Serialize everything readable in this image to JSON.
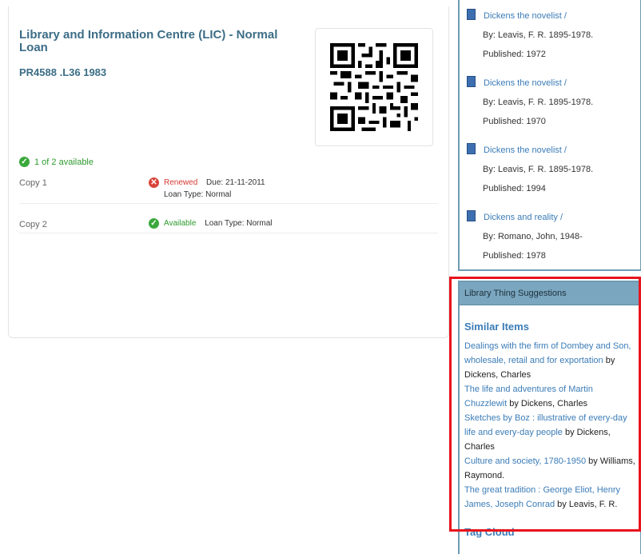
{
  "holding": {
    "location": "Library and Information Centre (LIC) - Normal Loan",
    "call_number": "PR4588 .L36 1983",
    "availability": "1 of 2 available",
    "copies": [
      {
        "label": "Copy 1",
        "status": "Renewed",
        "due": "Due: 21-11-2011",
        "loan_type": "Loan Type: Normal",
        "state": "error"
      },
      {
        "label": "Copy 2",
        "status": "Available",
        "loan_type": "Loan Type: Normal",
        "state": "ok"
      }
    ]
  },
  "related": [
    {
      "title": "Dickens the novelist /",
      "author": "By: Leavis, F. R. 1895-1978.",
      "published": "Published: 1972"
    },
    {
      "title": "Dickens the novelist /",
      "author": "By: Leavis, F. R. 1895-1978.",
      "published": "Published: 1970"
    },
    {
      "title": "Dickens the novelist /",
      "author": "By: Leavis, F. R. 1895-1978.",
      "published": "Published: 1994"
    },
    {
      "title": "Dickens and reality /",
      "author": "By: Romano, John, 1948-",
      "published": "Published: 1978"
    }
  ],
  "librarything": {
    "header": "Library Thing Suggestions",
    "similar_heading": "Similar Items",
    "items": [
      {
        "title": "Dealings with the firm of Dombey and Son, wholesale, retail and for exportation",
        "by": " by Dickens, Charles"
      },
      {
        "title": "The life and adventures of Martin Chuzzlewit",
        "by": " by Dickens, Charles"
      },
      {
        "title": "Sketches by Boz : illustrative of every-day life and every-day people",
        "by": " by Dickens, Charles"
      },
      {
        "title": "Culture and society, 1780-1950",
        "by": " by Williams, Raymond."
      },
      {
        "title": "The great tradition : George Eliot, Henry James, Joseph Conrad",
        "by": " by Leavis, F. R."
      }
    ],
    "tag_cloud": "Tag Cloud"
  },
  "icons": {
    "ok": "check-circle-icon",
    "error": "x-circle-icon",
    "book": "book-icon",
    "qr": "qr-code-icon"
  },
  "colors": {
    "highlight": "#e8141b",
    "accent": "#3b7cb7",
    "panel_header": "#7aa6bf",
    "available": "#2e9a2e",
    "renewed": "#d43a32"
  }
}
